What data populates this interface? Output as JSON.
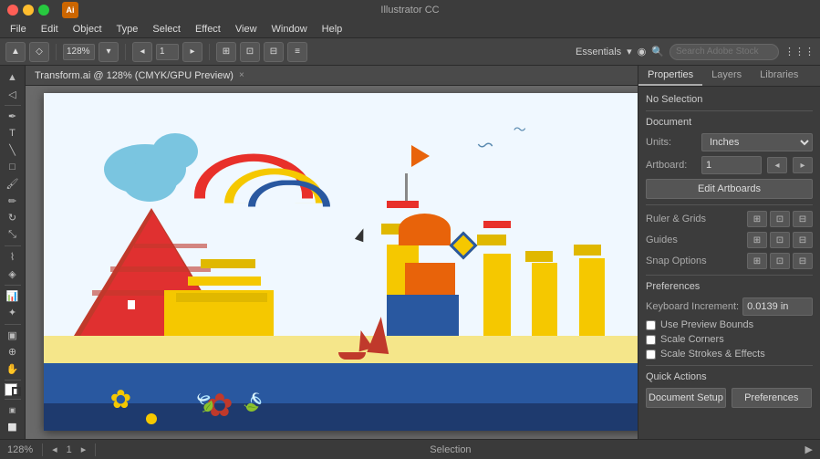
{
  "titlebar": {
    "app_name": "Ai",
    "title": "Illustrator CC",
    "doc_title": "Transform.ai @ 128% (CMYK/GPU Preview)"
  },
  "menubar": {
    "items": [
      "File",
      "Edit",
      "Object",
      "Type",
      "Select",
      "Effect",
      "View",
      "Window",
      "Help"
    ]
  },
  "toolbar": {
    "zoom_label": "128%",
    "artboard_label": "1",
    "essentials_label": "Essentials",
    "search_placeholder": "Search Adobe Stock"
  },
  "document_tab": {
    "label": "Transform.ai @ 128% (CMYK/GPU Preview)",
    "close": "×"
  },
  "right_panel": {
    "tabs": [
      "Properties",
      "Layers",
      "Libraries"
    ],
    "active_tab": "Properties",
    "no_selection": "No Selection",
    "document_section": "Document",
    "units_label": "Units:",
    "units_value": "Inches",
    "artboard_label": "Artboard:",
    "artboard_value": "1",
    "edit_artboards_btn": "Edit Artboards",
    "ruler_grids": "Ruler & Grids",
    "guides": "Guides",
    "snap_options": "Snap Options",
    "preferences": "Preferences",
    "keyboard_increment": "Keyboard Increment:",
    "keyboard_value": "0.0139 in",
    "use_preview_bounds": "Use Preview Bounds",
    "scale_corners": "Scale Corners",
    "scale_strokes": "Scale Strokes & Effects",
    "quick_actions": "Quick Actions",
    "document_setup_btn": "Document Setup",
    "preferences_btn": "Preferences"
  },
  "statusbar": {
    "zoom": "128%",
    "artboard_info": "1",
    "selection_label": "Selection",
    "arrow_label": "▶"
  },
  "colors": {
    "red": "#d42b2b",
    "orange": "#e8630a",
    "yellow": "#f5c800",
    "blue": "#2958a0",
    "light_blue": "#6ab4d8",
    "dark_blue": "#1e3a6e",
    "green": "#4a8c2a",
    "sky": "#e8f4fd",
    "sand": "#f0e68c",
    "crimson": "#c0392b",
    "gold": "#f5c800",
    "teal": "#2980b9",
    "dark_navy": "#1a2f5e"
  }
}
